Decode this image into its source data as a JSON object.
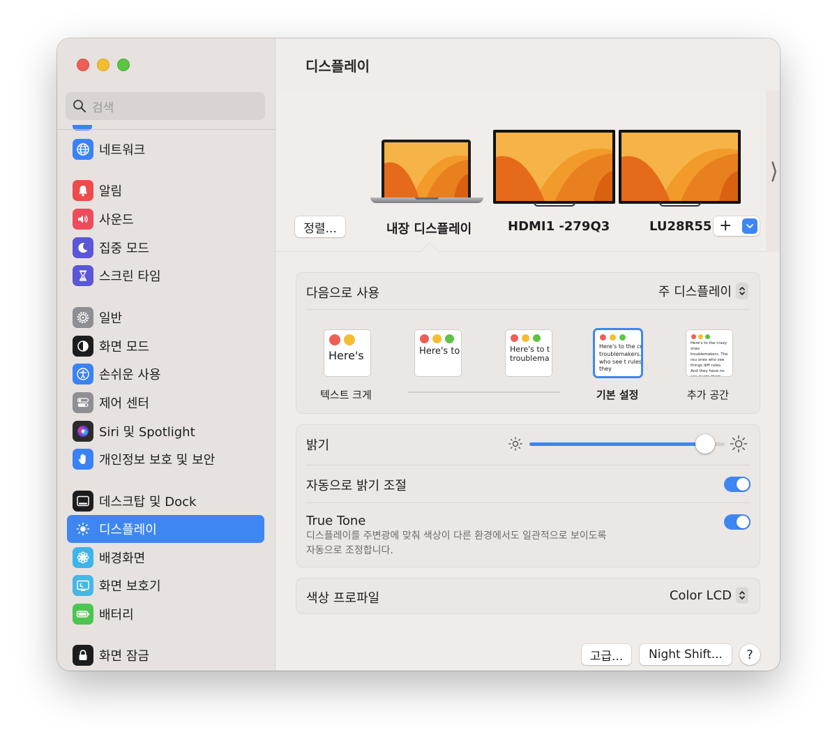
{
  "window": {
    "title": "디스플레이"
  },
  "sidebar": {
    "search": {
      "placeholder": "검색",
      "icon": "search-icon"
    },
    "items": [
      {
        "label": "네트워크",
        "icon": "globe-icon",
        "color": "#3a82f5"
      },
      {
        "label": "알림",
        "icon": "bell-icon",
        "color": "#ee4b4b"
      },
      {
        "label": "사운드",
        "icon": "speaker-icon",
        "color": "#ee4b5c"
      },
      {
        "label": "집중 모드",
        "icon": "moon-icon",
        "color": "#5b57d6"
      },
      {
        "label": "스크린 타임",
        "icon": "hourglass-icon",
        "color": "#5b57d6"
      },
      {
        "label": "일반",
        "icon": "gear-icon",
        "color": "#8e8e93"
      },
      {
        "label": "화면 모드",
        "icon": "appearance-icon",
        "color": "#1d1d1f"
      },
      {
        "label": "손쉬운 사용",
        "icon": "accessibility-icon",
        "color": "#3a82f5"
      },
      {
        "label": "제어 센터",
        "icon": "control-center-icon",
        "color": "#8e8e93"
      },
      {
        "label": "Siri 및 Spotlight",
        "icon": "siri-icon",
        "color": "#2b2b2b"
      },
      {
        "label": "개인정보 보호 및 보안",
        "icon": "hand-icon",
        "color": "#3a82f5"
      },
      {
        "label": "데스크탑 및 Dock",
        "icon": "dock-icon",
        "color": "#1d1d1f"
      },
      {
        "label": "디스플레이",
        "icon": "sun-icon",
        "color": "#3a82f5",
        "active": true
      },
      {
        "label": "배경화면",
        "icon": "flower-icon",
        "color": "#3fb4e8"
      },
      {
        "label": "화면 보호기",
        "icon": "screensaver-icon",
        "color": "#48b6e6"
      },
      {
        "label": "배터리",
        "icon": "battery-icon",
        "color": "#4cc552"
      },
      {
        "label": "화면 잠금",
        "icon": "lock-icon",
        "color": "#1d1d1f"
      }
    ]
  },
  "displays": {
    "arrange_button": "정렬...",
    "items": [
      {
        "label": "내장 디스플레이",
        "selected": true
      },
      {
        "label": "HDMI1 -279Q3"
      },
      {
        "label": "LU28R55"
      }
    ],
    "add_button": "+"
  },
  "use_as": {
    "label": "다음으로 사용",
    "value": "주 디스플레이"
  },
  "resolution": {
    "options": [
      {
        "caption": "텍스트 크게",
        "sample": "Here's"
      },
      {
        "caption": "",
        "sample": "Here's to troublem"
      },
      {
        "caption": "",
        "sample": "Here's to t troublema ones who"
      },
      {
        "caption": "기본 설정",
        "sample": "Here's to the cr troublemakers. ones who see t rules. And they",
        "selected": true
      },
      {
        "caption": "추가 공간",
        "sample": "Here's to the crazy ones troublemakers. The rou ones who see things diff rules. And they have no can quote them, disagre them. About the only th Because they change th"
      }
    ]
  },
  "brightness": {
    "label": "밝기",
    "level": 0.9
  },
  "auto_brightness": {
    "label": "자동으로 밝기 조절",
    "on": true
  },
  "true_tone": {
    "label": "True Tone",
    "description_line1": "디스플레이를 주변광에 맞춰 색상이 다른 환경에서도 일관적으로 보이도록",
    "description_line2": "자동으로 조정합니다.",
    "on": true
  },
  "color_profile": {
    "label": "색상 프로파일",
    "value": "Color LCD"
  },
  "footer": {
    "advanced_button": "고급...",
    "night_shift_button": "Night Shift...",
    "help_button": "?"
  },
  "colors": {
    "accent": "#3e86f2",
    "sidebar_bg": "#e7e2df",
    "content_bg": "#f0ecea"
  }
}
